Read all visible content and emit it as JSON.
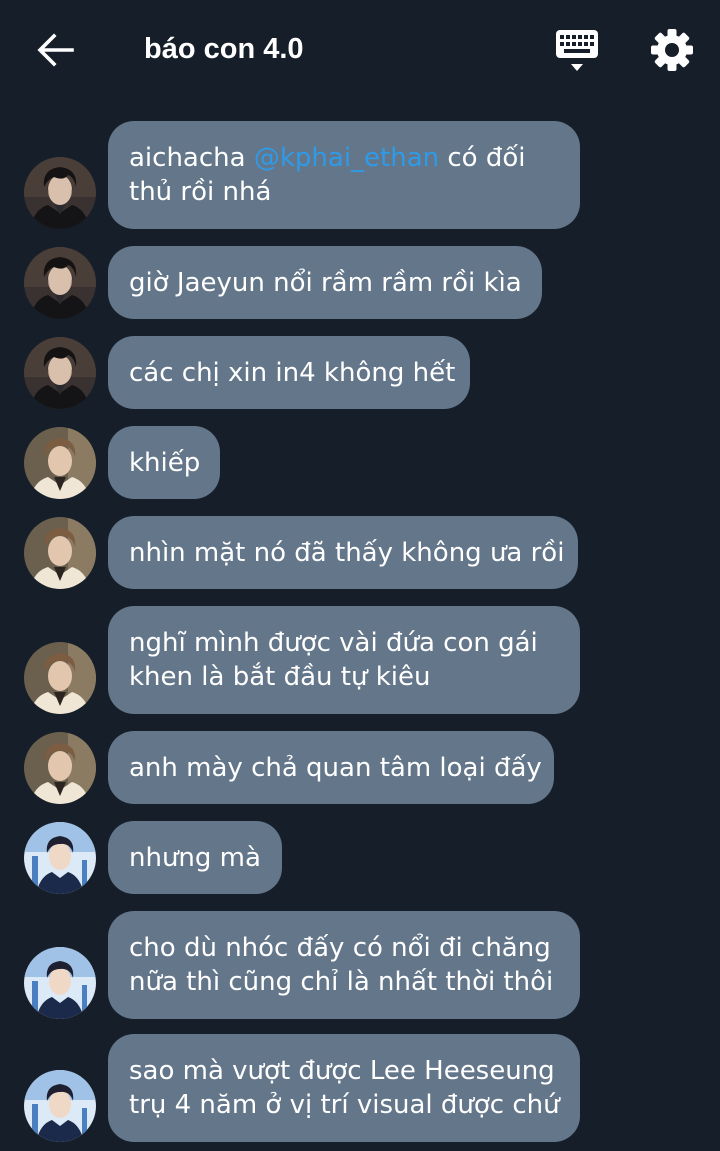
{
  "header": {
    "title": "báo con 4.0",
    "back_icon": "arrow-left-icon",
    "keyboard_icon": "keyboard-icon",
    "settings_icon": "gear-icon"
  },
  "colors": {
    "background": "#161e29",
    "bubble": "#64768a",
    "mention": "#2f9be8",
    "text": "#ffffff"
  },
  "messages": [
    {
      "avatar": "user-a",
      "pre": "aichacha ",
      "mention": "@kphai_ethan",
      "post": " có đối",
      "line2": "thủ rồi nhá"
    },
    {
      "avatar": "user-a",
      "line1": "giờ Jaeyun nổi rầm rầm rồi kìa"
    },
    {
      "avatar": "user-a",
      "line1": "các chị xin in4 không hết"
    },
    {
      "avatar": "user-b",
      "line1": "khiếp"
    },
    {
      "avatar": "user-b",
      "line1": "nhìn mặt nó đã thấy không ưa rồi"
    },
    {
      "avatar": "user-b",
      "line1": "nghĩ mình được vài đứa con gái",
      "line2": "khen là bắt đầu tự kiêu"
    },
    {
      "avatar": "user-b",
      "line1": "anh mày chả quan tâm loại đấy"
    },
    {
      "avatar": "user-c",
      "line1": "nhưng mà"
    },
    {
      "avatar": "user-c",
      "line1": "cho dù nhóc đấy có nổi đi chăng",
      "line2": "nữa thì cũng chỉ là nhất thời thôi"
    },
    {
      "avatar": "user-c",
      "line1": "sao mà vượt được Lee Heeseung",
      "line2": "trụ 4 năm ở vị trí visual được chứ"
    }
  ]
}
